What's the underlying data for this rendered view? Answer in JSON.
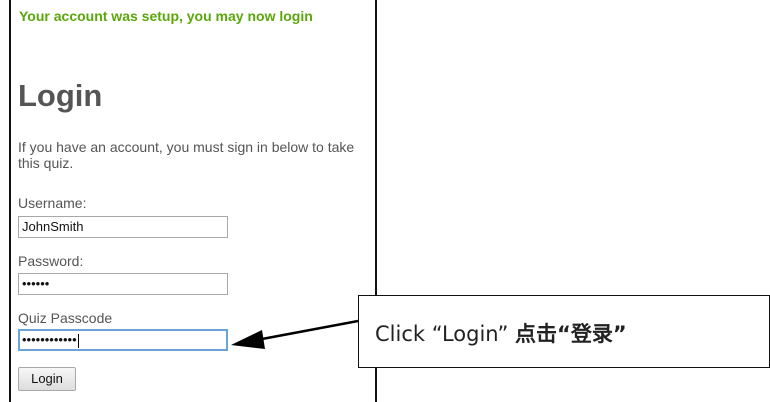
{
  "notice": "Your account was setup, you may now login",
  "title": "Login",
  "intro": "If you have an account, you must sign in below to take this quiz.",
  "fields": {
    "username": {
      "label": "Username:",
      "value": "JohnSmith"
    },
    "password": {
      "label": "Password:",
      "value": "••••••"
    },
    "passcode": {
      "label": "Quiz Passcode",
      "value": "••••••••••••"
    }
  },
  "login_button": "Login",
  "callout": {
    "text": "Click “Login” ",
    "text_cjk": "点击“登录”"
  },
  "colors": {
    "notice": "#5aa70b",
    "heading": "#555555",
    "focus_border": "#6aa3d8"
  }
}
